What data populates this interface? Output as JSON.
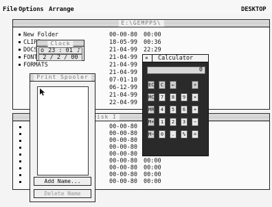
{
  "menubar": {
    "items": [
      "File",
      "Options",
      "Arrange"
    ],
    "right_label": "DESKTOP"
  },
  "main_window": {
    "title": "E:\\GEMPPS\\",
    "files": [
      {
        "name": "New Folder",
        "date": "00-00-80",
        "time": "00:00"
      },
      {
        "name": "CLIPB",
        "date": "18-05-99",
        "time": "00:36"
      },
      {
        "name": "DOCS",
        "date": "21-04-99",
        "time": "22:29"
      },
      {
        "name": "FONTS",
        "date": "21-04-99",
        "time": ""
      },
      {
        "name": "FORMATS",
        "date": "21-04-99",
        "time": ""
      },
      {
        "name": "",
        "date": "21-04-99",
        "time": ""
      },
      {
        "name": "",
        "date": "07-01-10",
        "time": ""
      },
      {
        "name": "",
        "date": "06-12-99",
        "time": ""
      },
      {
        "name": "",
        "date": "21-04-99",
        "time": ""
      },
      {
        "name": "",
        "date": "22-04-99",
        "time": ""
      }
    ]
  },
  "disk_window": {
    "title": "Disk I",
    "rows": [
      {
        "date": "00-00-80",
        "time": "00:00"
      },
      {
        "date": "00-00-80",
        "time": "00:00"
      },
      {
        "date": "00-00-80",
        "time": "00:00"
      },
      {
        "date": "00-00-80",
        "time": "00:00"
      },
      {
        "date": "00-00-80",
        "time": "00:00"
      },
      {
        "date": "00-00-80",
        "time": "00:00"
      },
      {
        "date": "00-00-80",
        "time": "00:00"
      },
      {
        "date": "00-00-80",
        "time": "00:00"
      },
      {
        "date": "00-00-80",
        "time": "00:00"
      }
    ]
  },
  "clock": {
    "title": "Clock",
    "time": "23 : 01",
    "date": "2 / 2 / 00",
    "alarm_marker": "♪",
    "left_marker": "o"
  },
  "spooler": {
    "title": "Print Spooler",
    "add_label": "Add Name...",
    "delete_label": "Delete Name"
  },
  "calculator": {
    "title": "Calculator",
    "display": "0",
    "close_glyph": "×",
    "rows": [
      [
        "EC",
        "C",
        "←",
        "÷"
      ],
      [
        "MC",
        "7",
        "8",
        "9",
        "×"
      ],
      [
        "MR",
        "4",
        "5",
        "6",
        "+"
      ],
      [
        "M+",
        "1",
        "2",
        "3",
        "−"
      ],
      [
        "M−",
        "0",
        ".",
        "%",
        "="
      ]
    ]
  }
}
